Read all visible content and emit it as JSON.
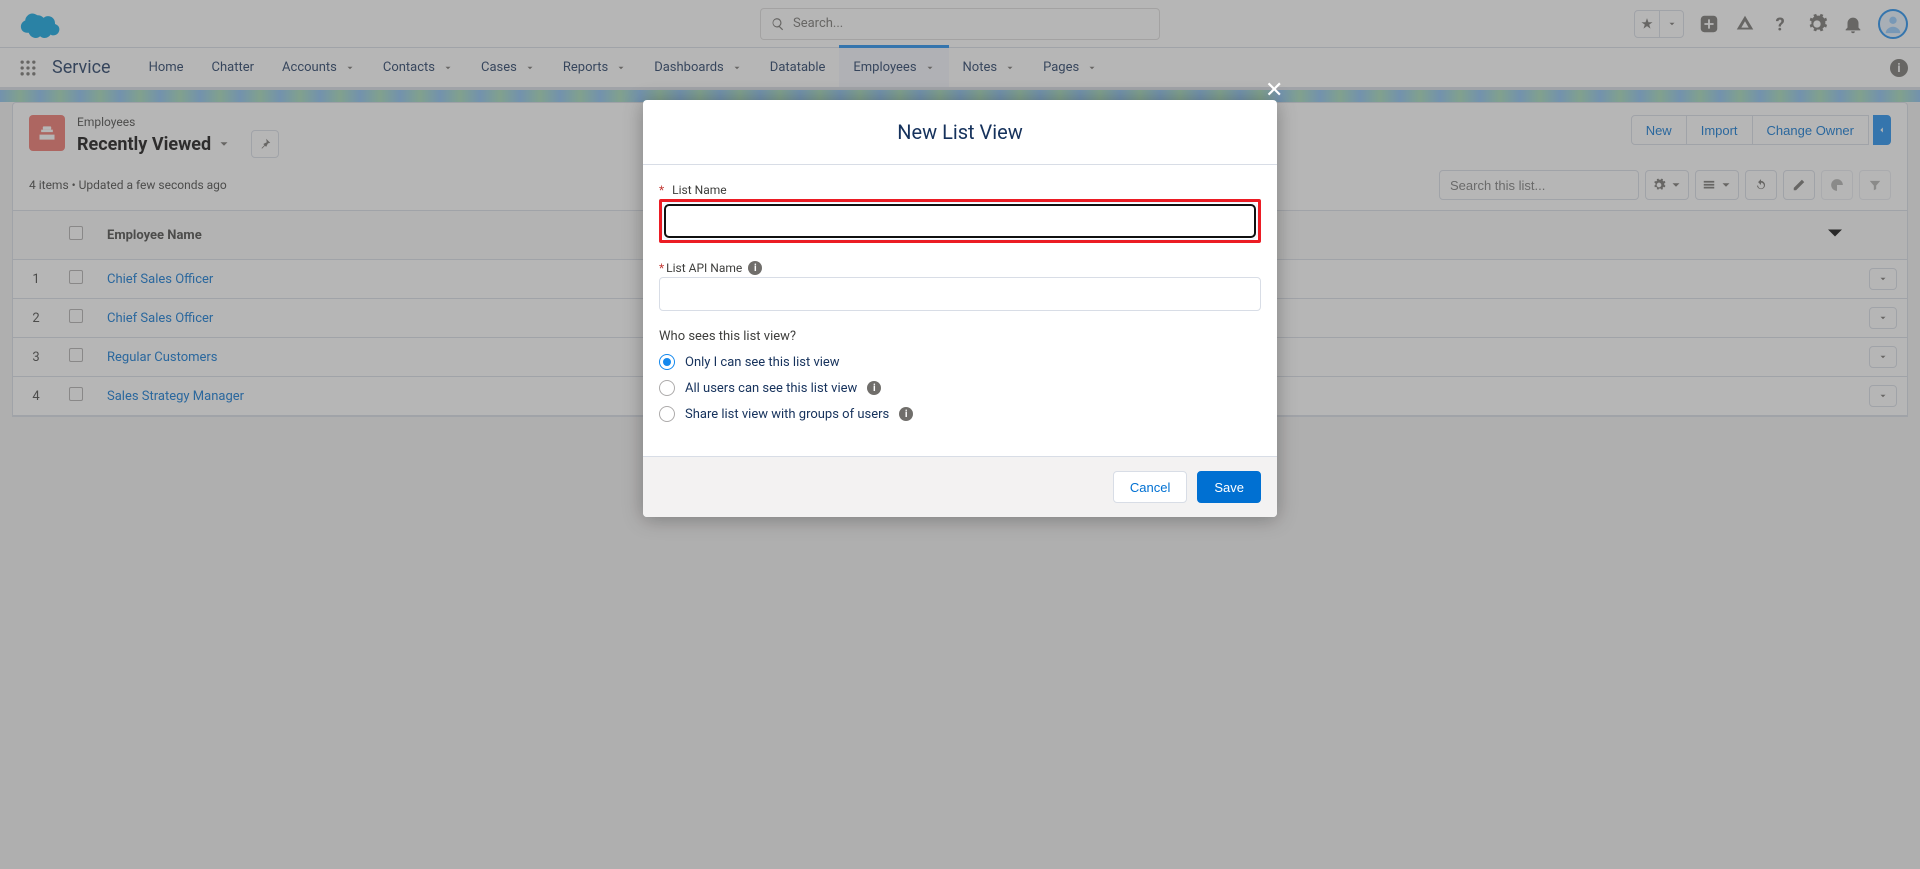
{
  "header": {
    "search_placeholder": "Search...",
    "app_name": "Service",
    "nav": [
      {
        "label": "Home",
        "hasMenu": false
      },
      {
        "label": "Chatter",
        "hasMenu": false
      },
      {
        "label": "Accounts",
        "hasMenu": true
      },
      {
        "label": "Contacts",
        "hasMenu": true
      },
      {
        "label": "Cases",
        "hasMenu": true
      },
      {
        "label": "Reports",
        "hasMenu": true
      },
      {
        "label": "Dashboards",
        "hasMenu": true
      },
      {
        "label": "Datatable",
        "hasMenu": false
      },
      {
        "label": "Employees",
        "hasMenu": true,
        "active": true
      },
      {
        "label": "Notes",
        "hasMenu": true
      },
      {
        "label": "Pages",
        "hasMenu": true
      }
    ]
  },
  "page": {
    "object_label": "Employees",
    "list_view": "Recently Viewed",
    "meta": "4 items • Updated a few seconds ago",
    "actions": {
      "new": "New",
      "import": "Import",
      "change_owner": "Change Owner"
    },
    "list_search_placeholder": "Search this list...",
    "column_header": "Employee Name",
    "rows": [
      {
        "n": "1",
        "name": "Chief Sales Officer"
      },
      {
        "n": "2",
        "name": "Chief Sales Officer"
      },
      {
        "n": "3",
        "name": "Regular Customers"
      },
      {
        "n": "4",
        "name": "Sales Strategy Manager"
      }
    ]
  },
  "modal": {
    "title": "New List View",
    "list_name_label": "List Name",
    "list_api_label": "List API Name",
    "visibility_q": "Who sees this list view?",
    "opts": {
      "only_me": "Only I can see this list view",
      "all": "All users can see this list view",
      "share": "Share list view with groups of users"
    },
    "cancel": "Cancel",
    "save": "Save"
  }
}
